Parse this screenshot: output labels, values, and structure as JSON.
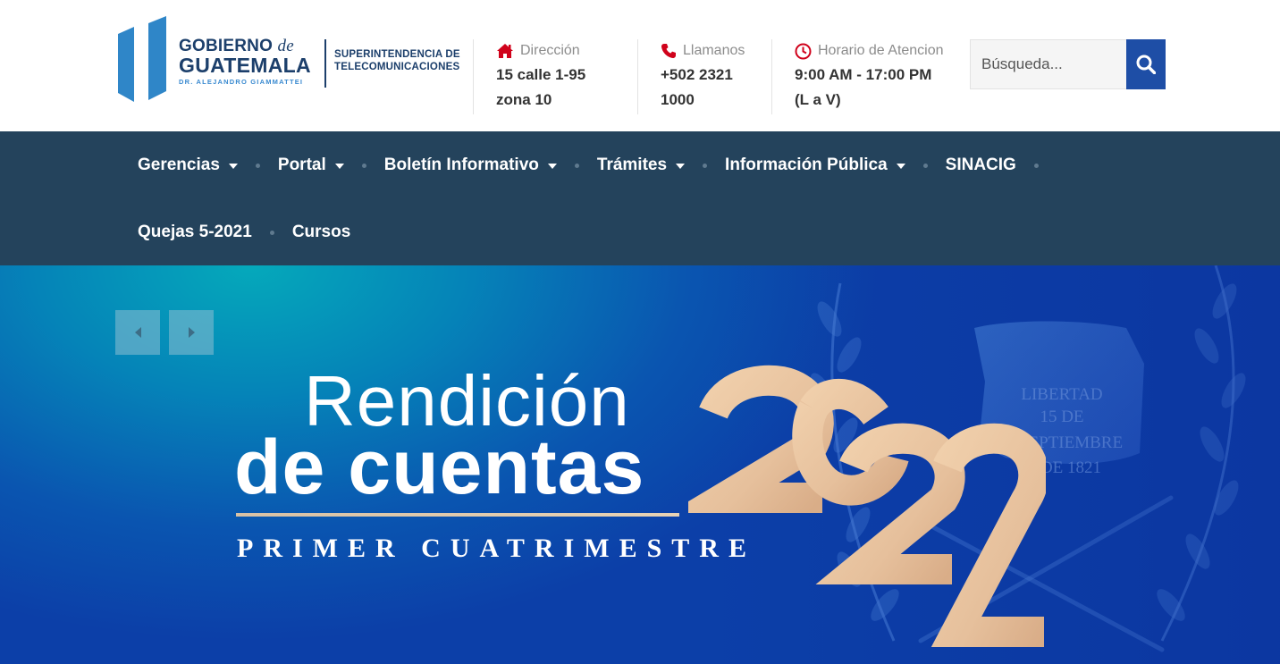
{
  "logo": {
    "line1": "GOBIERNO",
    "line1_de": "de",
    "line2": "GUATEMALA",
    "line3": "DR. ALEJANDRO GIAMMATTEI",
    "sit_line1": "SUPERINTENDENCIA DE",
    "sit_line2": "TELECOMUNICACIONES"
  },
  "contact": {
    "address": {
      "label": "Dirección",
      "line1": "15 calle 1-95",
      "line2": "zona 10",
      "icon": "home-icon"
    },
    "phone": {
      "label": "Llamanos",
      "line1": "+502 2321",
      "line2": "1000",
      "icon": "phone-icon"
    },
    "hours": {
      "label": "Horario de Atencion",
      "line1": "9:00 AM - 17:00 PM",
      "line2": "(L a V)",
      "icon": "clock-icon"
    }
  },
  "search": {
    "placeholder": "Búsqueda...",
    "icon": "search-icon"
  },
  "nav": {
    "row1": [
      {
        "label": "Gerencias",
        "dropdown": true
      },
      {
        "label": "Portal",
        "dropdown": true
      },
      {
        "label": "Boletín Informativo",
        "dropdown": true
      },
      {
        "label": "Trámites",
        "dropdown": true
      },
      {
        "label": "Información Pública",
        "dropdown": true
      },
      {
        "label": "SINACIG",
        "dropdown": false
      }
    ],
    "row2": [
      {
        "label": "Quejas 5-2021",
        "dropdown": false
      },
      {
        "label": "Cursos",
        "dropdown": false
      }
    ]
  },
  "hero": {
    "line1": "Rendición",
    "line2": "de cuentas",
    "year": "2022",
    "subtitle": "PRIMER CUATRIMESTRE",
    "emblem_text": [
      "LIBERTAD",
      "15 DE",
      "SEPTIEMBRE",
      "DE 1821"
    ]
  },
  "colors": {
    "brand_dark": "#1c3f6b",
    "nav_bg": "#24435c",
    "search_button": "#1e4ea6",
    "icon_red": "#d0021b",
    "gold": "#e3c2a0"
  }
}
